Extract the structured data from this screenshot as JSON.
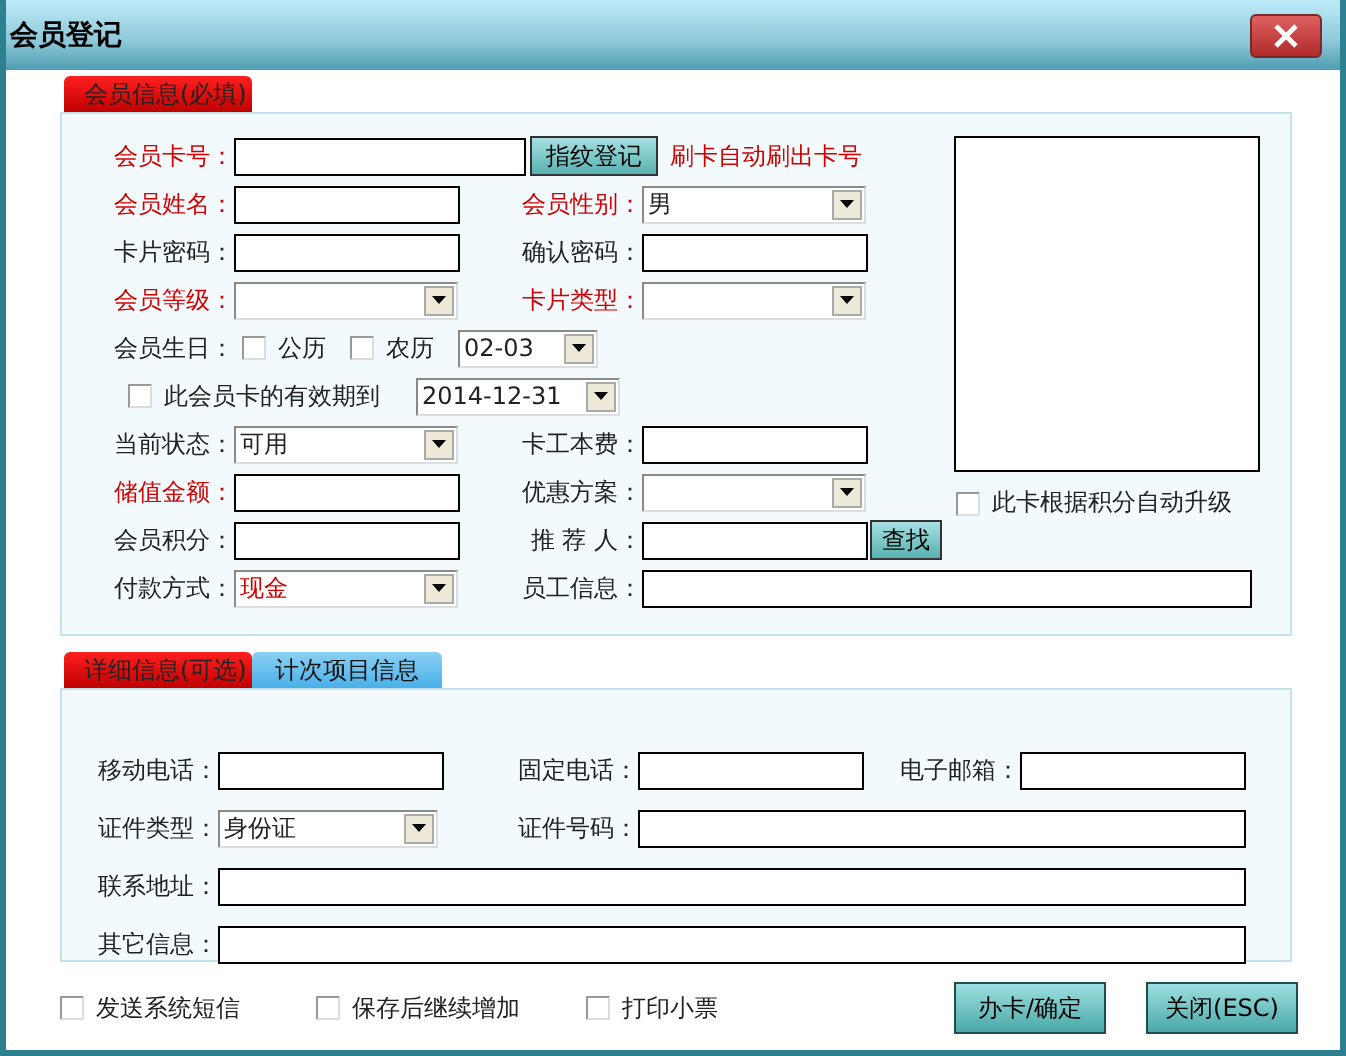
{
  "window": {
    "title": "会员登记"
  },
  "member_info": {
    "tab": {
      "label": "会员信息(必填)",
      "selected": true
    },
    "rows": [
      {
        "kind": "card",
        "label": "会员卡号：",
        "required": true,
        "button": "指纹登记",
        "note": "刷卡自动刷出卡号"
      },
      {
        "kind": "pair",
        "left": {
          "label": "会员姓名：",
          "required": true,
          "kind": "text"
        },
        "right": {
          "label": "会员性别：",
          "required": true,
          "kind": "select",
          "value": "男"
        }
      },
      {
        "kind": "pair",
        "left": {
          "label": "卡片密码：",
          "required": false,
          "kind": "text"
        },
        "right": {
          "label": "确认密码：",
          "required": false,
          "kind": "text"
        }
      },
      {
        "kind": "pair",
        "left": {
          "label": "会员等级：",
          "required": true,
          "kind": "select"
        },
        "right": {
          "label": "卡片类型：",
          "required": true,
          "kind": "select"
        }
      },
      {
        "kind": "birthday",
        "label": "会员生日：",
        "options": [
          {
            "label": "公历",
            "checked": false
          },
          {
            "label": "农历",
            "checked": false
          }
        ],
        "value": "02-03"
      },
      {
        "kind": "expiry",
        "label": "此会员卡的有效期到",
        "checked": false,
        "value": "2014-12-31"
      },
      {
        "kind": "pair",
        "left": {
          "label": "当前状态：",
          "required": false,
          "kind": "select",
          "value": "可用"
        },
        "right": {
          "label": "卡工本费：",
          "required": false,
          "kind": "text"
        }
      },
      {
        "kind": "pair",
        "left": {
          "label": "储值金额：",
          "required": true,
          "kind": "text"
        },
        "right": {
          "label": "优惠方案：",
          "required": false,
          "kind": "select"
        }
      },
      {
        "kind": "pair",
        "left": {
          "label": "会员积分：",
          "required": false,
          "kind": "text"
        },
        "right": {
          "label": "推 荐 人：",
          "required": false,
          "kind": "text",
          "button": "查找"
        }
      },
      {
        "kind": "pair",
        "left": {
          "label": "付款方式：",
          "required": false,
          "kind": "select",
          "value": "现金",
          "color": "#cc0000"
        },
        "right": {
          "label": "员工信息：",
          "required": false,
          "kind": "wide"
        }
      }
    ],
    "auto_upgrade": {
      "label": "此卡根据积分自动升级",
      "checked": false
    }
  },
  "detail_tabs": [
    {
      "label": "详细信息(可选)",
      "selected": true
    },
    {
      "label": "计次项目信息",
      "selected": false
    }
  ],
  "detail_rows": [
    [
      {
        "label": "移动电话：",
        "kind": "text"
      },
      {
        "label": "固定电话：",
        "kind": "text"
      },
      {
        "label": "电子邮箱：",
        "kind": "text"
      }
    ],
    [
      {
        "label": "证件类型：",
        "kind": "select",
        "value": "身份证"
      },
      {
        "label": "证件号码：",
        "kind": "text"
      }
    ],
    [
      {
        "label": "联系地址：",
        "kind": "text"
      }
    ],
    [
      {
        "label": "其它信息：",
        "kind": "text"
      }
    ]
  ],
  "options": [
    {
      "label": "发送系统短信",
      "checked": false
    },
    {
      "label": "保存后继续增加",
      "checked": false
    },
    {
      "label": "打印小票",
      "checked": false
    }
  ],
  "buttons": [
    "办卡/确定",
    "关闭(ESC)"
  ]
}
